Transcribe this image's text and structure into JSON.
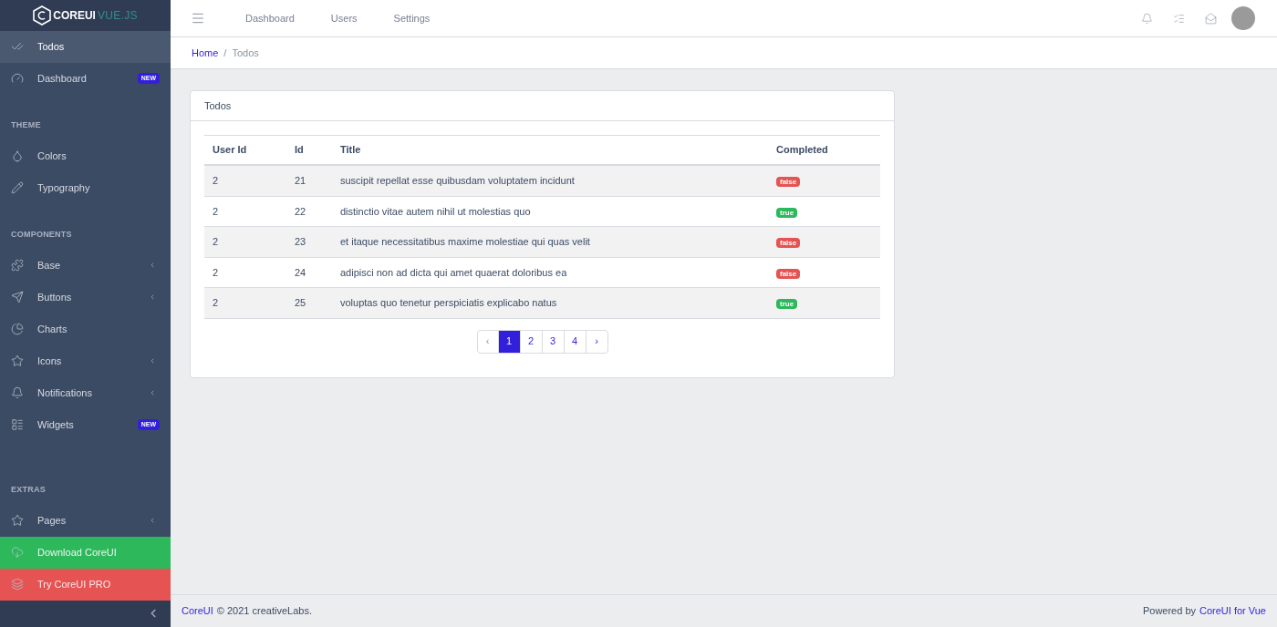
{
  "brand": {
    "name": "COREUI",
    "suffix": "VUE.JS"
  },
  "sidebar": {
    "items": [
      {
        "kind": "item",
        "label": "Todos",
        "selected": true
      },
      {
        "kind": "item",
        "label": "Dashboard",
        "badge": "NEW",
        "selected": false
      },
      {
        "kind": "title",
        "label": "THEME"
      },
      {
        "kind": "item",
        "label": "Colors",
        "selected": false
      },
      {
        "kind": "item",
        "label": "Typography",
        "selected": false
      },
      {
        "kind": "title",
        "label": "COMPONENTS"
      },
      {
        "kind": "item",
        "label": "Base",
        "dropdown": true,
        "selected": false
      },
      {
        "kind": "item",
        "label": "Buttons",
        "dropdown": true,
        "selected": false
      },
      {
        "kind": "item",
        "label": "Charts",
        "selected": false
      },
      {
        "kind": "item",
        "label": "Icons",
        "dropdown": true,
        "selected": false
      },
      {
        "kind": "item",
        "label": "Notifications",
        "dropdown": true,
        "selected": false
      },
      {
        "kind": "item",
        "label": "Widgets",
        "badge": "NEW",
        "selected": false
      },
      {
        "kind": "title",
        "label": "EXTRAS"
      },
      {
        "kind": "item",
        "label": "Pages",
        "dropdown": true,
        "selected": false
      },
      {
        "kind": "success",
        "label": "Download CoreUI"
      },
      {
        "kind": "danger",
        "label": "Try CoreUI PRO"
      }
    ]
  },
  "header": {
    "nav": [
      "Dashboard",
      "Users",
      "Settings"
    ]
  },
  "breadcrumb": {
    "separator": "/",
    "items": [
      {
        "label": "Home",
        "link": true
      },
      {
        "label": "Todos",
        "link": false
      }
    ]
  },
  "card": {
    "title": "Todos",
    "table": {
      "columns": [
        "User Id",
        "Id",
        "Title",
        "Completed"
      ],
      "rows": [
        {
          "user_id": "2",
          "id": "21",
          "title": "suscipit repellat esse quibusdam voluptatem incidunt",
          "completed_label": "false",
          "completed": false
        },
        {
          "user_id": "2",
          "id": "22",
          "title": "distinctio vitae autem nihil ut molestias quo",
          "completed_label": "true",
          "completed": true
        },
        {
          "user_id": "2",
          "id": "23",
          "title": "et itaque necessitatibus maxime molestiae qui quas velit",
          "completed_label": "false",
          "completed": false
        },
        {
          "user_id": "2",
          "id": "24",
          "title": "adipisci non ad dicta qui amet quaerat doloribus ea",
          "completed_label": "false",
          "completed": false
        },
        {
          "user_id": "2",
          "id": "25",
          "title": "voluptas quo tenetur perspiciatis explicabo natus",
          "completed_label": "true",
          "completed": true
        }
      ]
    },
    "pagination": {
      "prev": "‹",
      "next": "›",
      "pages": [
        {
          "label": "1",
          "selected": true
        },
        {
          "label": "2",
          "selected": false
        },
        {
          "label": "3",
          "selected": false
        },
        {
          "label": "4",
          "selected": false
        }
      ]
    }
  },
  "footer": {
    "left_link": "CoreUI",
    "left_text": "© 2021 creativeLabs.",
    "right_text": "Powered by",
    "right_link": "CoreUI for Vue"
  }
}
